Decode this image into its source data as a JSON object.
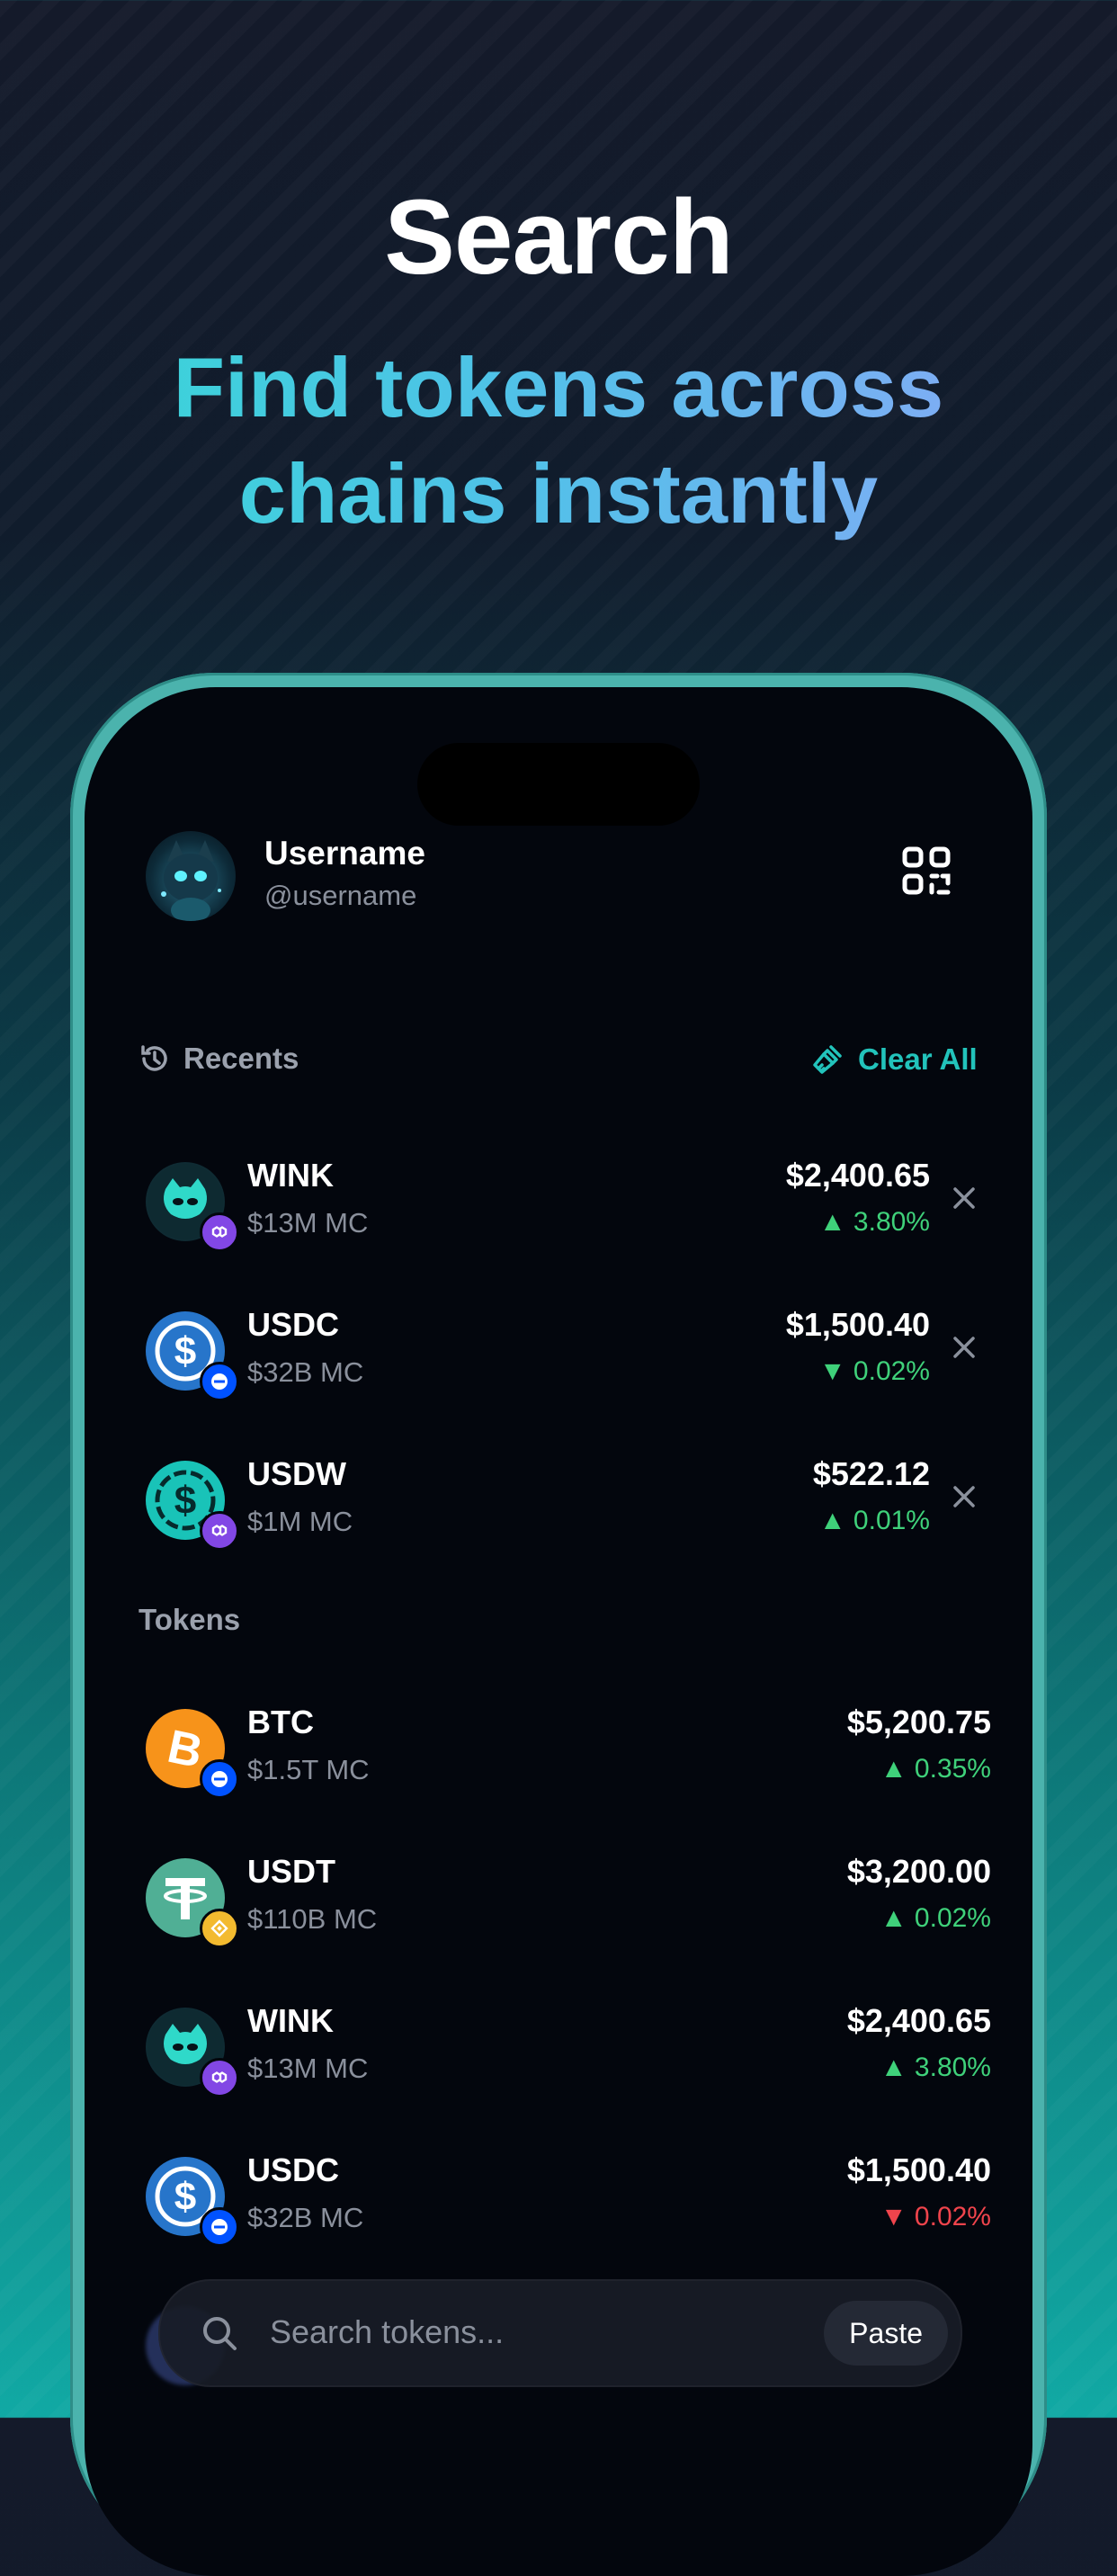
{
  "hero": {
    "title": "Search",
    "subtitle_line1": "Find tokens across",
    "subtitle_line2": "chains instantly"
  },
  "profile": {
    "name": "Username",
    "handle": "@username"
  },
  "recents": {
    "label": "Recents",
    "clear_label": "Clear All",
    "items": [
      {
        "symbol": "WINK",
        "market_cap": "$13M MC",
        "price": "$2,400.65",
        "change": "3.80%",
        "direction": "up",
        "chain": "polygon"
      },
      {
        "symbol": "USDC",
        "market_cap": "$32B MC",
        "price": "$1,500.40",
        "change": "0.02%",
        "direction": "down",
        "chain": "base"
      },
      {
        "symbol": "USDW",
        "market_cap": "$1M MC",
        "price": "$522.12",
        "change": "0.01%",
        "direction": "up",
        "chain": "polygon"
      }
    ]
  },
  "tokens": {
    "label": "Tokens",
    "items": [
      {
        "symbol": "BTC",
        "market_cap": "$1.5T MC",
        "price": "$5,200.75",
        "change": "0.35%",
        "direction": "up",
        "chain": "base"
      },
      {
        "symbol": "USDT",
        "market_cap": "$110B MC",
        "price": "$3,200.00",
        "change": "0.02%",
        "direction": "up",
        "chain": "bnb"
      },
      {
        "symbol": "WINK",
        "market_cap": "$13M MC",
        "price": "$2,400.65",
        "change": "3.80%",
        "direction": "up",
        "chain": "polygon"
      },
      {
        "symbol": "USDC",
        "market_cap": "$32B MC",
        "price": "$1,500.40",
        "change": "0.02%",
        "direction": "down",
        "chain": "base"
      }
    ]
  },
  "search": {
    "placeholder": "Search tokens...",
    "paste_label": "Paste"
  },
  "colors": {
    "accent": "#22c3bb",
    "positive": "#3fd17a",
    "negative": "#f0444c",
    "screen_bg": "#03060d"
  }
}
